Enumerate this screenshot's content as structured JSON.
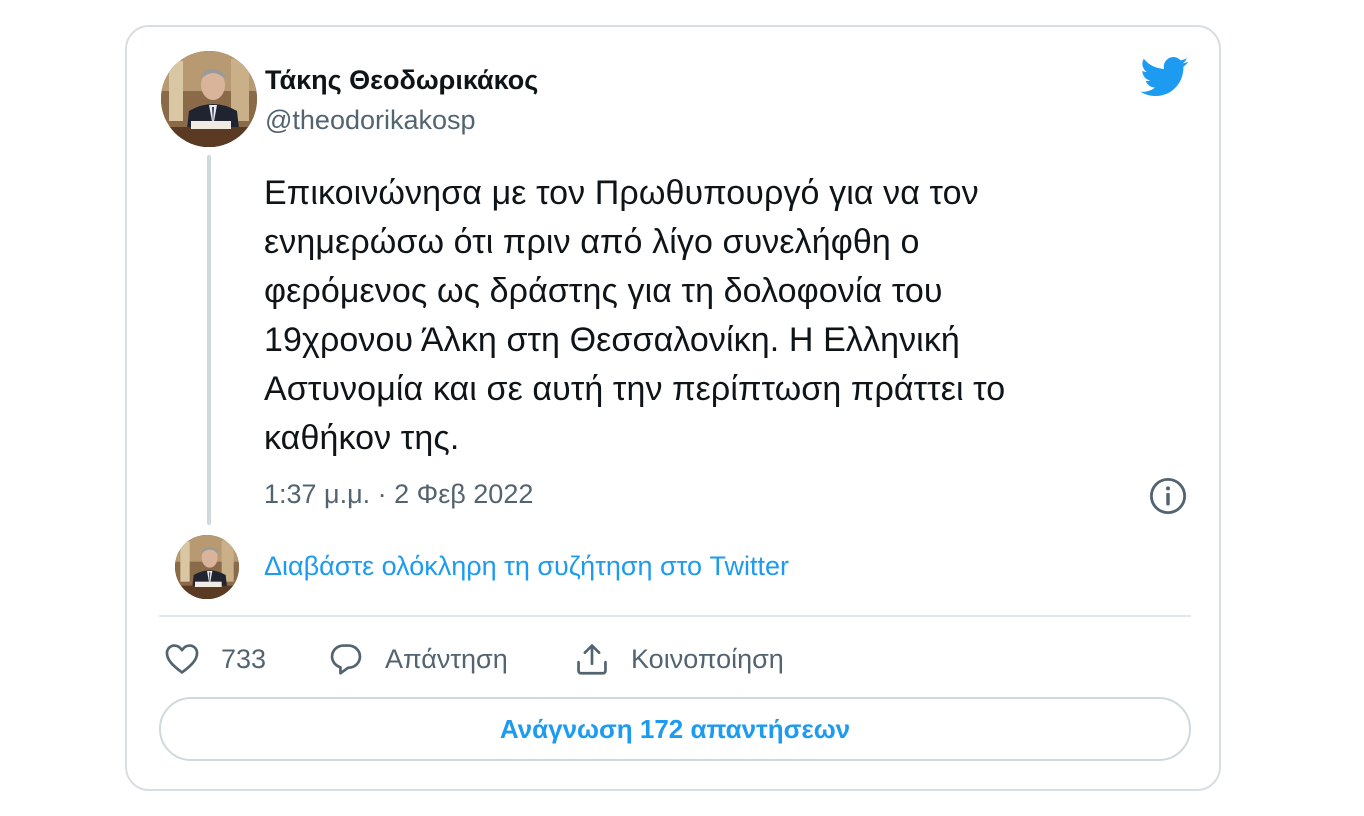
{
  "author": {
    "name": "Τάκης Θεοδωρικάκος",
    "handle": "@theodorikakosp"
  },
  "tweet": {
    "lines": [
      "Επικοινώνησα με τον Πρωθυπουργό  για να τον",
      "ενημερώσω ότι πριν από λίγο συνελήφθη ο",
      "φερόμενος ως δράστης για τη δολοφονία του",
      "19χρονου Άλκη στη Θεσσαλονίκη. Η Ελληνική",
      "Αστυνομία και σε αυτή την περίπτωση πράττει το",
      "καθήκον της."
    ],
    "timestamp": "1:37 μ.μ. · 2 Φεβ 2022"
  },
  "thread": {
    "read_link": "Διαβάστε ολόκληρη τη συζήτηση στο Twitter"
  },
  "actions": {
    "like_count": "733",
    "reply_label": "Απάντηση",
    "share_label": "Κοινοποίηση"
  },
  "replies_button": {
    "label": "Ανάγνωση 172 απαντήσεων"
  },
  "icons": {
    "brand": "twitter-bird-icon",
    "info": "info-icon",
    "like": "heart-icon",
    "reply": "speech-bubble-icon",
    "share": "share-icon"
  },
  "colors": {
    "accent": "#1d9bf0",
    "text_primary": "#0f1419",
    "text_secondary": "#536471",
    "border": "#cfd9de"
  }
}
